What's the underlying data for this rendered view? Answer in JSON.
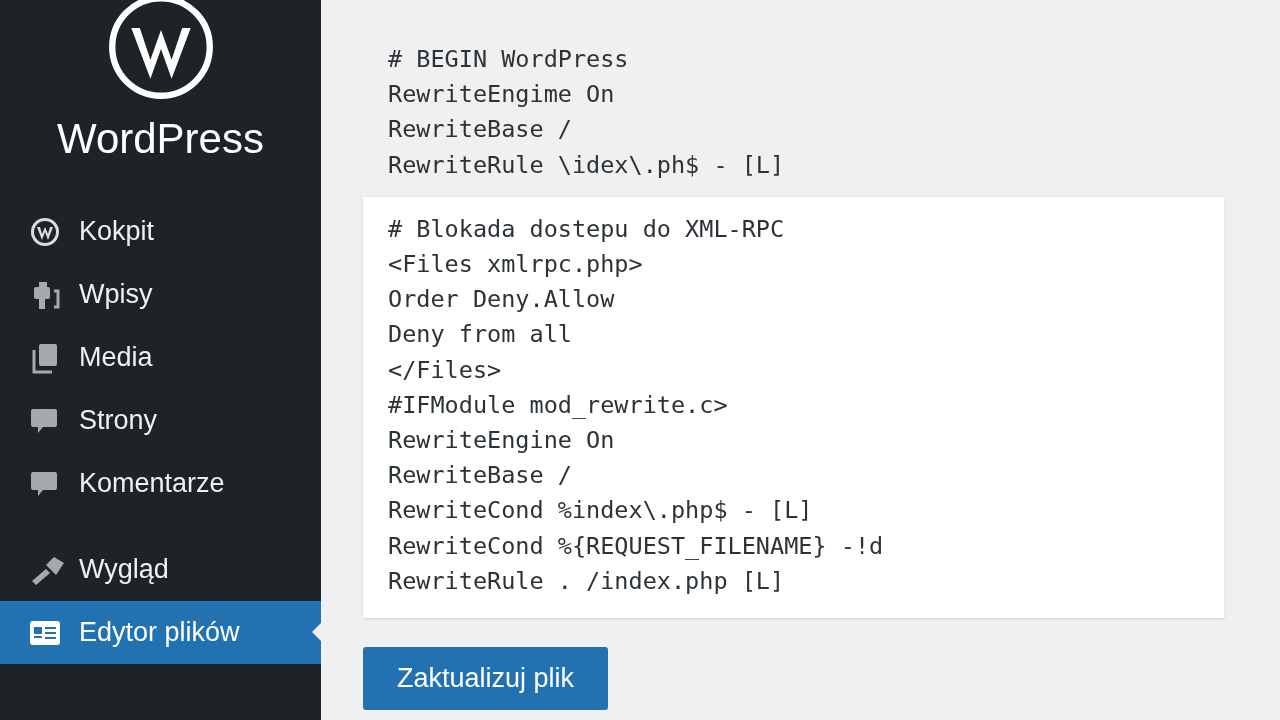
{
  "sidebar": {
    "brand": "WordPress",
    "items": [
      {
        "label": "Kokpit",
        "kind": "wp",
        "selected": false
      },
      {
        "label": "Wpisy",
        "kind": "pin",
        "selected": false
      },
      {
        "label": "Media",
        "kind": "media",
        "selected": false
      },
      {
        "label": "Strony",
        "kind": "bubble",
        "selected": false
      },
      {
        "label": "Komentarze",
        "kind": "bubble",
        "selected": false
      },
      {
        "label": "Wygląd",
        "kind": "brush",
        "selected": false
      },
      {
        "label": "Edytor plików",
        "kind": "card",
        "selected": true
      }
    ]
  },
  "editor": {
    "blocks": [
      {
        "kind": "plain",
        "lines": [
          "# BEGIN WordPress",
          "RewriteEngime On",
          "RewriteBase /",
          "RewriteRule \\idex\\.ph$ - [L]"
        ]
      },
      {
        "kind": "panel",
        "lines": [
          "# Blokada dostepu do XML-RPC",
          "<Files xmlrpc.php>",
          "Order Deny.Allow",
          "Deny from all",
          "</Files>",
          "#IFModule mod_rewrite.c>",
          "RewriteEngine On",
          "RewriteBase /",
          "RewriteCond %index\\.php$ - [L]",
          "RewriteCond %{REQUEST_FILENAME} -!d",
          "RewriteRule . /index.php [L]"
        ]
      }
    ]
  },
  "update_button": "Zaktualizuj plik"
}
